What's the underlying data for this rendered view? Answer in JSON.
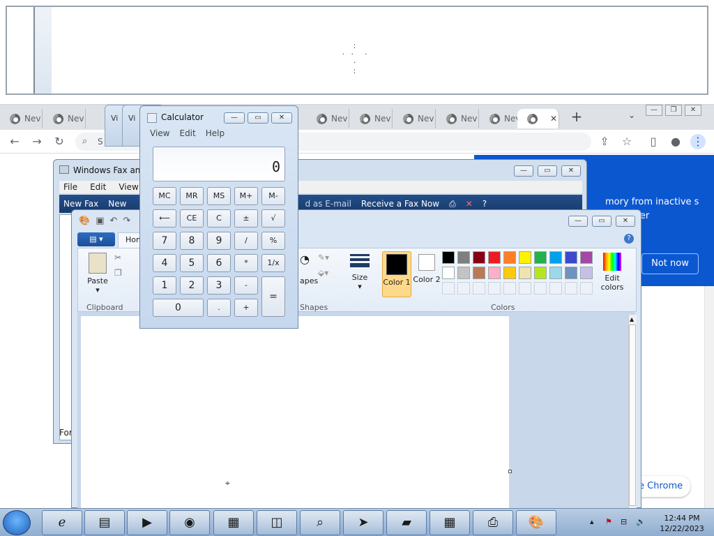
{
  "chrome": {
    "tabs": [
      {
        "label": "Nev"
      },
      {
        "label": "Nev"
      },
      {
        "label": "Nev"
      },
      {
        "label": "Nev"
      },
      {
        "label": "Nev"
      },
      {
        "label": "Nev"
      },
      {
        "label": "Nev"
      },
      {
        "label": "Nev"
      }
    ],
    "active_tab_label": "",
    "new_tab": "+",
    "omnibox_text": "S",
    "popup_text": "mory from inactive s and other",
    "popup_button": "Not now",
    "pill_text": "e Chrome"
  },
  "fax": {
    "title": "Windows Fax and",
    "menu": [
      "File",
      "Edit",
      "View",
      "T"
    ],
    "toolbar": [
      "New Fax",
      "New",
      "d as E-mail",
      "Receive a Fax Now"
    ],
    "status_text": "For"
  },
  "paint": {
    "home_tab": "Hom",
    "groups": {
      "clipboard": "Clipboard",
      "shapes": "Shapes",
      "colors": "Colors"
    },
    "paste": "Paste",
    "shapes_label": "apes",
    "size": "Size",
    "color1": "Color 1",
    "color2": "Color 2",
    "edit_colors": "Edit colors",
    "palette_row1": [
      "#000000",
      "#7f7f7f",
      "#880015",
      "#ed1c24",
      "#ff7f27",
      "#fff200",
      "#22b14c",
      "#00a2e8",
      "#3f48cc",
      "#a349a4"
    ],
    "palette_row2": [
      "#ffffff",
      "#c3c3c3",
      "#b97a57",
      "#ffaec9",
      "#ffc90e",
      "#efe4b0",
      "#b5e61d",
      "#99d9ea",
      "#7092be",
      "#c8bfe7"
    ]
  },
  "calculator": {
    "title": "Calculator",
    "menu": [
      "View",
      "Edit",
      "Help"
    ],
    "display": "0",
    "keys": {
      "mc": "MC",
      "mr": "MR",
      "ms": "MS",
      "mplus": "M+",
      "mminus": "M-",
      "back": "⟵",
      "ce": "CE",
      "c": "C",
      "pm": "±",
      "sqrt": "√",
      "k7": "7",
      "k8": "8",
      "k9": "9",
      "div": "/",
      "pct": "%",
      "k4": "4",
      "k5": "5",
      "k6": "6",
      "mul": "*",
      "recip": "1/x",
      "k1": "1",
      "k2": "2",
      "k3": "3",
      "sub": "-",
      "eq": "=",
      "k0": "0",
      "dot": ".",
      "add": "+"
    }
  },
  "ghosts": [
    "Vi",
    "Vi"
  ],
  "taskbar": {
    "time": "12:44 PM",
    "date": "12/22/2023"
  }
}
